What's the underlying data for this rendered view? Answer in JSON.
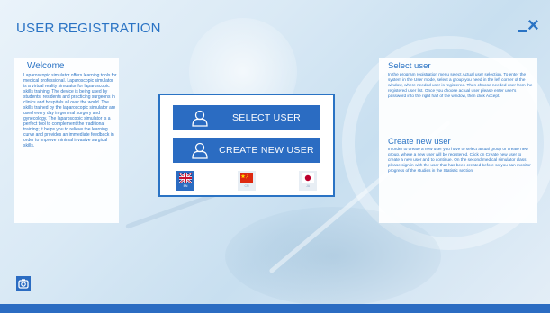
{
  "header": {
    "title": "USER REGISTRATION",
    "close_icon": "minimize-close-icon"
  },
  "welcome": {
    "title": "Welcome",
    "text": "Laparoscopic simulator offers learning tools for medical professional. Laparoscopic simulator is a virtual reality simulator for laparoscopic skills training. The device is being used by students, residents and practicing surgeons in clinics and hospitals all over the world. The skills trained by the laparoscopic simulator are used every day in general surgery and gynecology. The laparoscopic simulator is a perfect tool to complement the traditional training; it helps you to relieve the learning curve and provides an immediate feedback in order to improve minimal invasive surgical skills."
  },
  "help": {
    "select_title": "Select user",
    "select_text": "In the program registration menu select Actual user selection. To enter the system in the User mode, select a group you need in the left corner of the window, where needed user is registered. Then choose needed user from the registered user list. Once you choose actual user please enter user's password into the right half of the window, then click Accept.",
    "create_title": "Create new user",
    "create_text": "In order to create a new user you have to select actual group or create new group, where a new user will be registered. Click on Create new user to create a new user and to continue. On the second medical simulator class please sign in with the user that has been created before so you can monitor progress of the studies in the Statistic section."
  },
  "menu": {
    "select_user": "SELECT USER",
    "create_user": "CREATE NEW USER",
    "user_icon": "user-icon"
  },
  "languages": [
    {
      "code": "EN",
      "icon": "uk-flag-icon",
      "active": true
    },
    {
      "code": "CN",
      "icon": "china-flag-icon",
      "active": false
    },
    {
      "code": "JA",
      "icon": "japan-flag-icon",
      "active": false
    }
  ],
  "footer": {
    "camera_icon": "camera-icon"
  },
  "colors": {
    "accent": "#2b6cc2",
    "text": "#2a73c4",
    "panel": "#ffffff"
  }
}
